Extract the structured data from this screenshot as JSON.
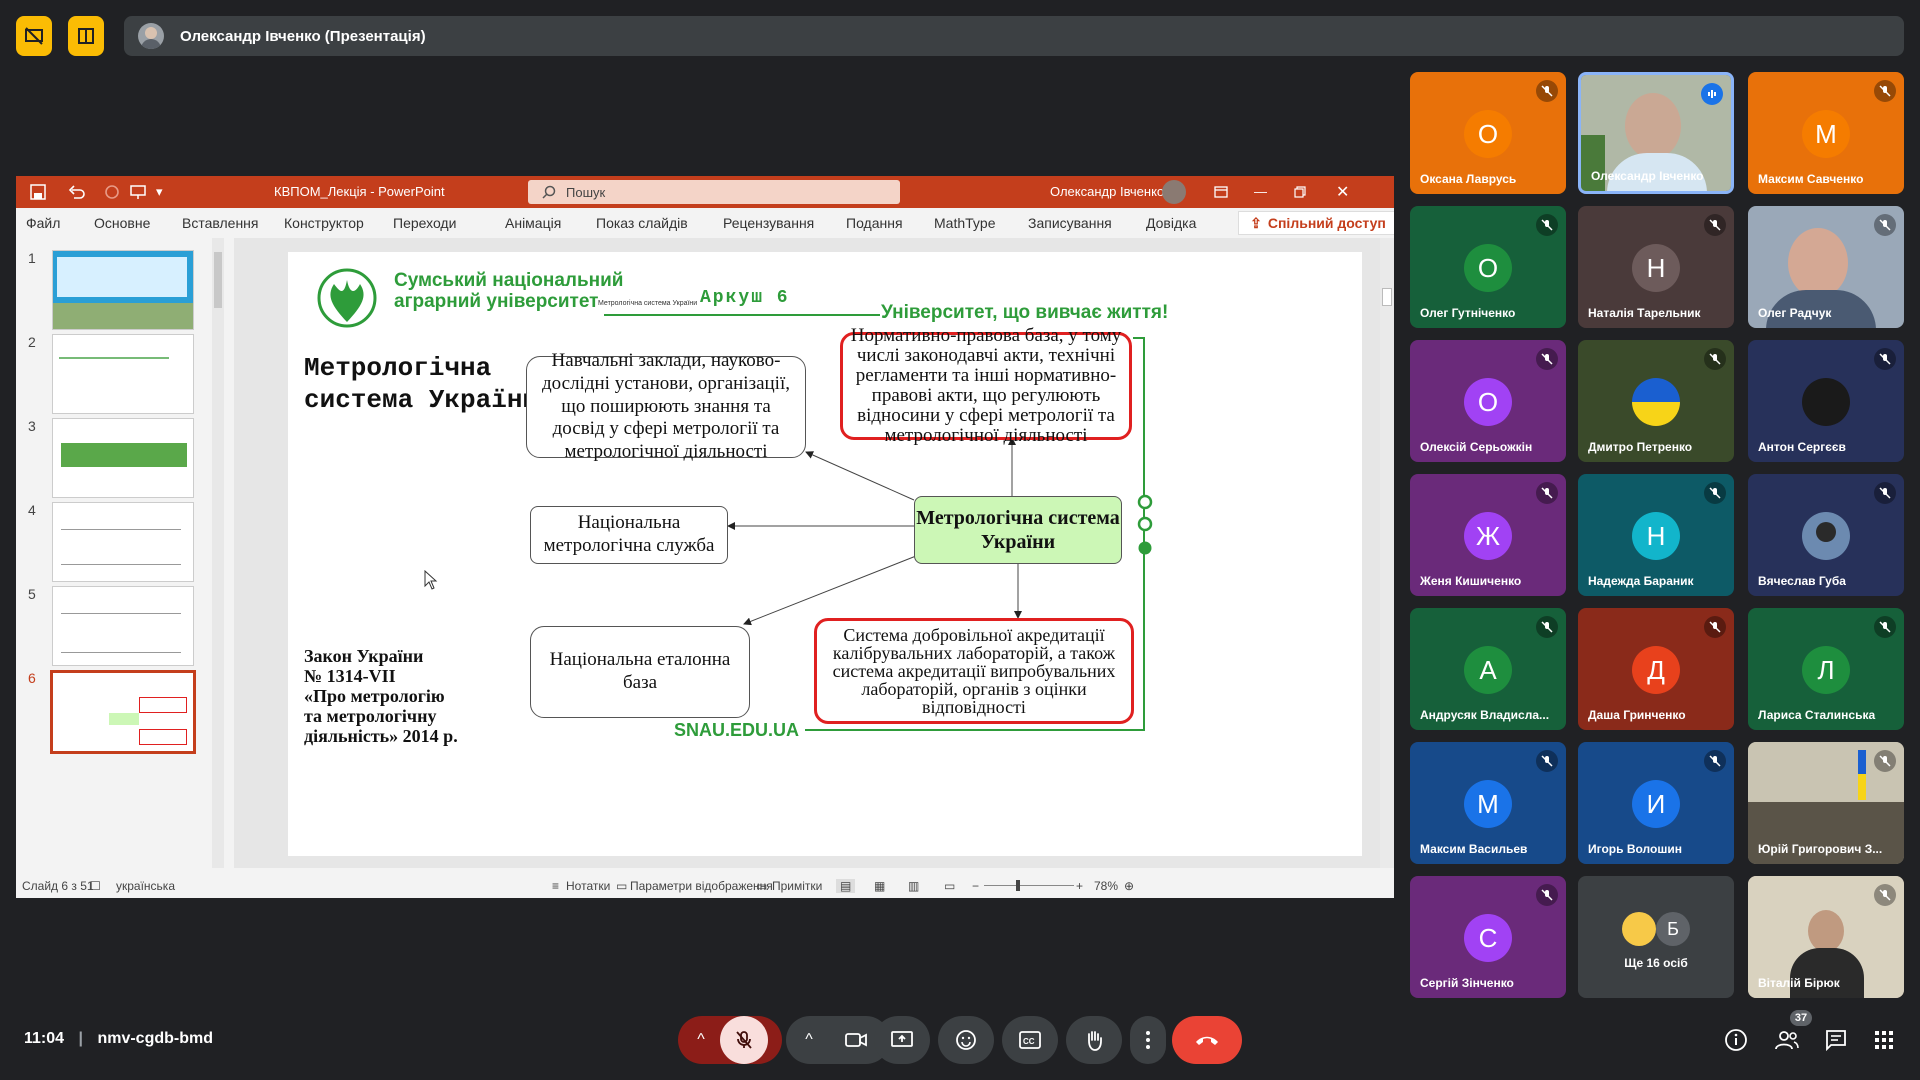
{
  "presenter_bar": {
    "title": "Олександр Івченко (Презентація)"
  },
  "ppt": {
    "window_title": "КВПОМ_Лекція  -  PowerPoint",
    "search_placeholder": "Пошук",
    "user": "Олександр Івченко",
    "menu": [
      "Файл",
      "Основне",
      "Вставлення",
      "Конструктор",
      "Переходи",
      "Анімація",
      "Показ слайдів",
      "Рецензування",
      "Подання",
      "MathType",
      "Записування",
      "Довідка"
    ],
    "share": "Спільний доступ",
    "thumb_numbers": [
      "1",
      "2",
      "3",
      "4",
      "5",
      "6"
    ],
    "status": {
      "slide": "Слайд 6 з 51",
      "lang": "українська",
      "notes": "Нотатки",
      "view": "Параметри відображення",
      "comments": "Примітки",
      "zoom": "78%"
    }
  },
  "slide": {
    "univ_line1": "Сумський національний",
    "univ_line2": "аграрний університет",
    "small_caption": "Метрологічна система України",
    "sheet": "Аркуш 6",
    "motto": "Університет, що вивчає життя!",
    "heading1": "Метрологічна",
    "heading2": "система України",
    "box_edu": "Навчальні заклади, науково-дослідні установи, організації, що поширюють знання та досвід у сфері метрології та метрологічної діяльності",
    "box_legal": "Нормативно-правова база, у тому числі законодавчі акти, технічні регламенти та інші нормативно-правові акти, що регулюють відносини у сфері метрології та метрологічної діяльності",
    "box_service": "Національна метрологічна служба",
    "box_center": "Метрологічна система України",
    "box_standard": "Національна еталонна база",
    "box_accred": "Система добровільної акредитації калібрувальних лабораторій, а також система акредитації випробувальних лабораторій, органів з оцінки відповідності",
    "law1": "Закон України",
    "law2": "№ 1314-VII",
    "law3": "«Про метрологію",
    "law4": "та метрологічну",
    "law5": "діяльність» 2014 р.",
    "site": "SNAU.EDU.UA"
  },
  "participants": [
    {
      "name": "Оксана Лаврусь",
      "initial": "О",
      "color": "#e8710a"
    },
    {
      "name": "Олександр Івченко",
      "initial": "",
      "color": "#5f6b5a"
    },
    {
      "name": "Максим Савченко",
      "initial": "М",
      "color": "#e8710a"
    },
    {
      "name": "Олег Гутніченко",
      "initial": "О",
      "color": "#1e8e3e"
    },
    {
      "name": "Наталія Тарельник",
      "initial": "Н",
      "color": "#5f6368"
    },
    {
      "name": "Олег Радчук",
      "initial": "",
      "color": "#7d8a9a"
    },
    {
      "name": "Олексій Серьожкін",
      "initial": "О",
      "color": "#a142f4"
    },
    {
      "name": "Дмитро Петренко",
      "initial": "",
      "color": "#2f4a3a"
    },
    {
      "name": "Антон Сергєєв",
      "initial": "",
      "color": "#3b4a73"
    },
    {
      "name": "Женя Кишиченко",
      "initial": "Ж",
      "color": "#a142f4"
    },
    {
      "name": "Надежда Бараник",
      "initial": "Н",
      "color": "#12b5cb"
    },
    {
      "name": "Вячеслав Губа",
      "initial": "",
      "color": "#3b4a73"
    },
    {
      "name": "Андрусяк Владисла...",
      "initial": "А",
      "color": "#1e8e3e"
    },
    {
      "name": "Даша Гринченко",
      "initial": "Д",
      "color": "#e8411c"
    },
    {
      "name": "Лариса Сталинська",
      "initial": "Л",
      "color": "#1e8e3e"
    },
    {
      "name": "Максим Васильев",
      "initial": "М",
      "color": "#1a73e8"
    },
    {
      "name": "Игорь Волошин",
      "initial": "И",
      "color": "#1a73e8"
    },
    {
      "name": "Юрій Григорович З...",
      "initial": "",
      "color": "#8a8a7a"
    },
    {
      "name": "Сергій Зінченко",
      "initial": "С",
      "color": "#a142f4"
    },
    {
      "name": "Ще 16 осіб",
      "initial": "",
      "color": "#3c4043"
    },
    {
      "name": "Віталій Бірюк",
      "initial": "",
      "color": "#8b7d6b"
    }
  ],
  "more_people": {
    "avatar_letter": "Б"
  },
  "bottom": {
    "time": "11:04",
    "meeting_code": "nmv-cgdb-bmd",
    "people_count": "37"
  },
  "colors": {
    "accent_yellow": "#fbbc04",
    "ppt_red": "#c43e1c",
    "slide_green": "#2e9c3a",
    "end_call": "#ea4335"
  }
}
